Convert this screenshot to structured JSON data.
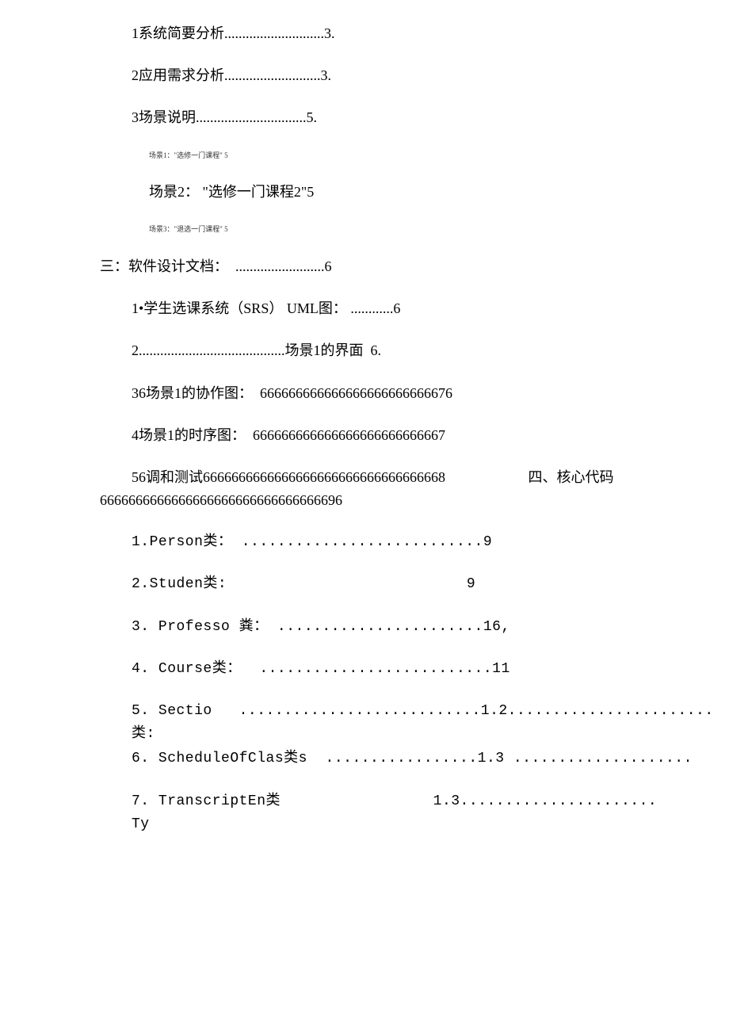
{
  "toc": {
    "item1": "1系统简要分析............................3.",
    "item2": "2应用需求分析...........................3.",
    "item3": "3场景说明...............................5.",
    "sub1": "场景1：\"选修一门课程\" 5",
    "sub2": "场景2： \"选修一门课程2\"5",
    "sub3": "场景3：\"退选一门课程\" 5",
    "section3": "三：软件设计文档：  .........................6",
    "item3_1": "1•学生选课系统（SRS） UML图： ............6",
    "item3_2": "2.........................................场景1的界面  6.",
    "item3_3": "36场景1的协作图：  666666666666666666666666676",
    "item3_4": "4场景1的时序图：  666666666666666666666666667",
    "item3_5a": "56调和测试6666666666666666666666666666666668",
    "item3_5b": "四、核心代码",
    "item3_5c": "6666666666666666666666666666666696",
    "item4_1": "1.Person类： ...........................9",
    "item4_2a": "2.Studen类:",
    "item4_2b": "9",
    "item4_3": "3. Professo 粪： .......................16,",
    "item4_4": "4. Course类：  ..........................11",
    "item4_5a": "5. Sectio   ...........................1.2.......................",
    "item4_5b": "类:",
    "item4_6": "6. ScheduleOfClas类s  .................1.3 ....................",
    "item4_7a": "7. TranscriptEn类",
    "item4_7b": "1.3......................",
    "item4_7c": "Ty"
  }
}
